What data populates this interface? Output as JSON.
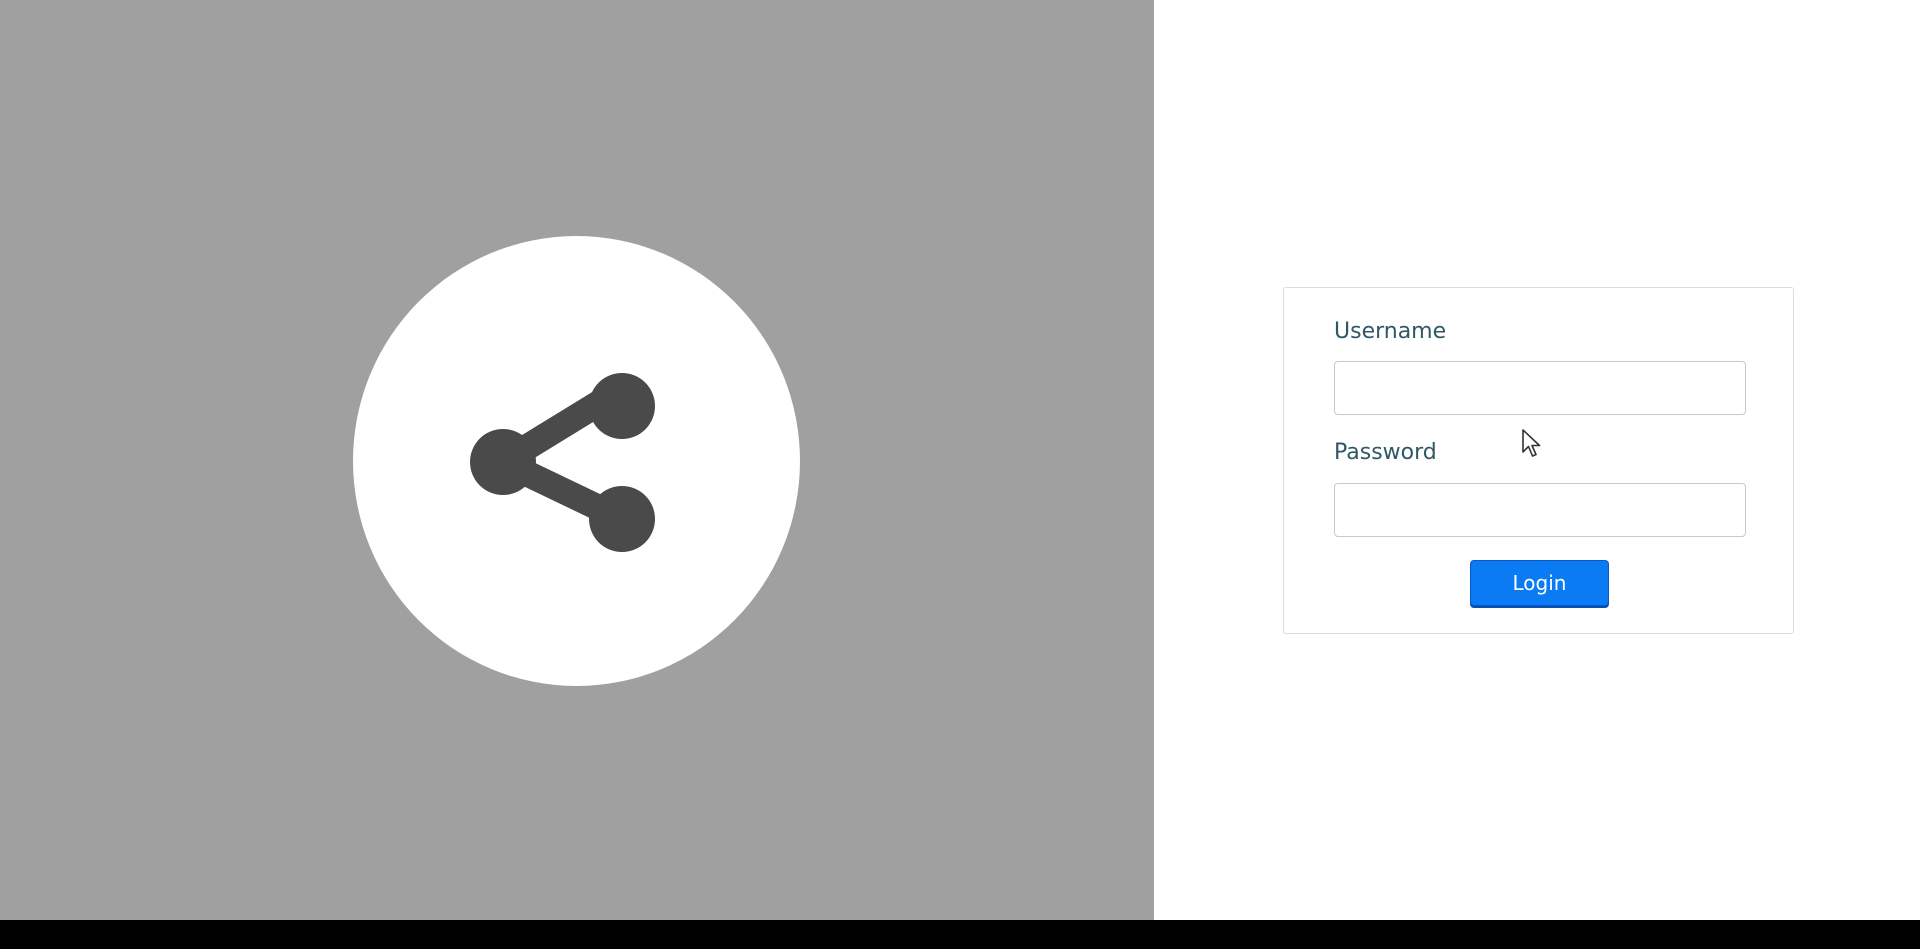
{
  "login": {
    "username_label": "Username",
    "username_value": "",
    "username_placeholder": "",
    "password_label": "Password",
    "password_value": "",
    "password_placeholder": "",
    "login_button_label": "Login"
  },
  "logo": {
    "icon": "share-icon"
  },
  "colors": {
    "left_panel_background": "#a0a0a0",
    "logo_circle": "#ffffff",
    "share_icon": "#4a4a4a",
    "label_text": "#2f5766",
    "login_button": "#0b7bf3",
    "page_background": "#ffffff",
    "bottom_bar": "#000000"
  }
}
